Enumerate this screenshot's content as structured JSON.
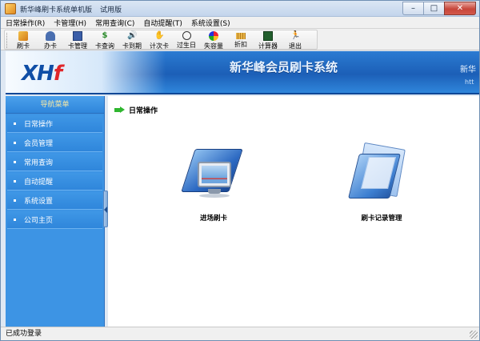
{
  "window": {
    "title": "新华峰刷卡系统单机版",
    "trial": "试用版",
    "minimize": "–",
    "maximize": "□",
    "close": "✕"
  },
  "menu": [
    "日常操作(R)",
    "卡管理(H)",
    "常用查询(C)",
    "自动提醒(T)",
    "系统设置(S)"
  ],
  "toolbar": [
    {
      "label": "刷卡",
      "icon": "swipe-card-icon"
    },
    {
      "label": "办卡",
      "icon": "person-icon"
    },
    {
      "label": "卡管理",
      "icon": "book-icon"
    },
    {
      "label": "卡查询",
      "icon": "dollar-icon",
      "glyph": "$"
    },
    {
      "label": "卡到期",
      "icon": "speaker-icon",
      "glyph": "🔊"
    },
    {
      "label": "计次卡",
      "icon": "hand-icon",
      "glyph": "✋"
    },
    {
      "label": "过生日",
      "icon": "clock-icon"
    },
    {
      "label": "失容量",
      "icon": "ball-icon"
    },
    {
      "label": "折扣",
      "icon": "ruler-icon"
    },
    {
      "label": "计算器",
      "icon": "calculator-icon"
    },
    {
      "label": "退出",
      "icon": "exit-runner-icon",
      "glyph": "🏃"
    }
  ],
  "banner": {
    "logo_main": "XH",
    "logo_accent": "f",
    "title": "新华峰会员刷卡系统",
    "right_text": "新华",
    "right_url": "htt"
  },
  "sidebar": {
    "header": "导航菜单",
    "items": [
      "日常操作",
      "会员管理",
      "常用查询",
      "自动提醒",
      "系统设置",
      "公司主页"
    ]
  },
  "main": {
    "section_title": "日常操作",
    "features": [
      {
        "label": "进场刷卡",
        "icon": "entry-card-icon"
      },
      {
        "label": "刷卡记录管理",
        "icon": "card-records-icon"
      }
    ]
  },
  "status": {
    "text": "已成功登录"
  }
}
